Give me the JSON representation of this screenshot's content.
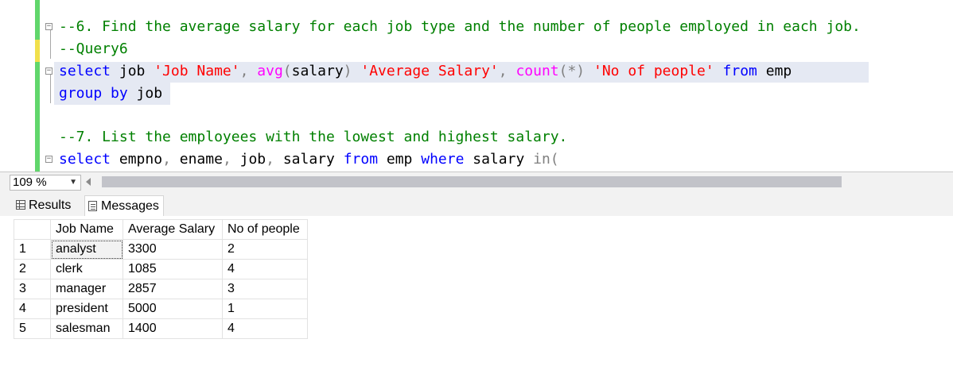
{
  "editor": {
    "lines": [
      {
        "parts": [
          {
            "t": "--6. Find the average salary for each job type and the number of people employed in each job.",
            "c": "cm"
          }
        ]
      },
      {
        "parts": [
          {
            "t": "--Query6",
            "c": "cm"
          }
        ]
      },
      {
        "parts": [
          {
            "t": "select",
            "c": "kw"
          },
          {
            "t": " job ",
            "c": ""
          },
          {
            "t": "'Job Name'",
            "c": "str"
          },
          {
            "t": ", ",
            "c": "gr"
          },
          {
            "t": "avg",
            "c": "fn"
          },
          {
            "t": "(",
            "c": "gr"
          },
          {
            "t": "salary",
            "c": ""
          },
          {
            "t": ") ",
            "c": "gr"
          },
          {
            "t": "'Average Salary'",
            "c": "str"
          },
          {
            "t": ", ",
            "c": "gr"
          },
          {
            "t": "count",
            "c": "fn"
          },
          {
            "t": "(*) ",
            "c": "gr"
          },
          {
            "t": "'No of people'",
            "c": "str"
          },
          {
            "t": " ",
            "c": ""
          },
          {
            "t": "from",
            "c": "kw"
          },
          {
            "t": " emp",
            "c": ""
          }
        ]
      },
      {
        "parts": [
          {
            "t": "group by",
            "c": "kw"
          },
          {
            "t": " job",
            "c": ""
          }
        ]
      },
      {
        "parts": []
      },
      {
        "parts": [
          {
            "t": "--7. List the employees with the lowest and highest salary.",
            "c": "cm"
          }
        ]
      },
      {
        "parts": [
          {
            "t": "select",
            "c": "kw"
          },
          {
            "t": " empno",
            "c": ""
          },
          {
            "t": ", ",
            "c": "gr"
          },
          {
            "t": "ename",
            "c": ""
          },
          {
            "t": ", ",
            "c": "gr"
          },
          {
            "t": "job",
            "c": ""
          },
          {
            "t": ", ",
            "c": "gr"
          },
          {
            "t": "salary ",
            "c": ""
          },
          {
            "t": "from",
            "c": "kw"
          },
          {
            "t": " emp ",
            "c": ""
          },
          {
            "t": "where",
            "c": "kw"
          },
          {
            "t": " salary ",
            "c": ""
          },
          {
            "t": "in(",
            "c": "gr"
          }
        ]
      }
    ]
  },
  "zoom": {
    "value": "109 %"
  },
  "tabs": {
    "results": "Results",
    "messages": "Messages"
  },
  "grid": {
    "headers": [
      "Job Name",
      "Average Salary",
      "No of people"
    ],
    "rows": [
      {
        "n": "1",
        "job": "analyst",
        "avg": "3300",
        "cnt": "2"
      },
      {
        "n": "2",
        "job": "clerk",
        "avg": "1085",
        "cnt": "4"
      },
      {
        "n": "3",
        "job": "manager",
        "avg": "2857",
        "cnt": "3"
      },
      {
        "n": "4",
        "job": "president",
        "avg": "5000",
        "cnt": "1"
      },
      {
        "n": "5",
        "job": "salesman",
        "avg": "1400",
        "cnt": "4"
      }
    ]
  },
  "colors": {
    "keyword": "#0000ff",
    "string": "#ff0000",
    "comment": "#008000",
    "function": "#ff00ff",
    "gutter_changed": "#61d66b",
    "gutter_unsaved": "#f1e04b"
  },
  "icons": {
    "fold": "minus-box-icon",
    "results": "grid-icon",
    "messages": "document-icon",
    "dropdown": "chevron-down-icon",
    "scroll": "arrow-left-icon"
  }
}
